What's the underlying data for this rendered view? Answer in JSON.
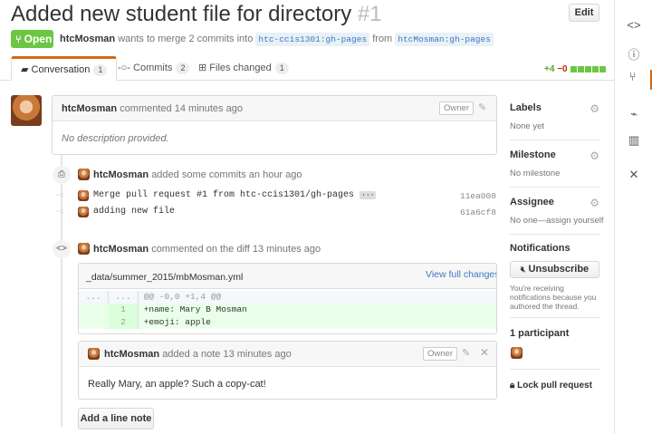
{
  "pr": {
    "title": "Added new student file for directory",
    "number": "#1",
    "edit_label": "Edit",
    "state": "Open",
    "author": "htcMosman",
    "merge_text": "wants to merge 2 commits into",
    "base_branch": "htc-ccis1301:gh-pages",
    "from_text": "from",
    "head_branch": "htcMosman:gh-pages"
  },
  "tabs": [
    {
      "label": "Conversation",
      "count": "1"
    },
    {
      "label": "Commits",
      "count": "2"
    },
    {
      "label": "Files changed",
      "count": "1"
    }
  ],
  "diffstat": {
    "additions": "+4",
    "deletions": "−0"
  },
  "comment1": {
    "author": "htcMosman",
    "action": "commented",
    "time": "14 minutes ago",
    "badge": "Owner",
    "body": "No description provided."
  },
  "commits_event": {
    "author": "htcMosman",
    "text": "added some commits an hour ago",
    "commits": [
      {
        "message": "Merge pull request #1 from htc-ccis1301/gh-pages",
        "ellipsis": "···",
        "sha": "11ea008"
      },
      {
        "message": "adding new file",
        "sha": "61a6cf8"
      }
    ]
  },
  "diff_event": {
    "author": "htcMosman",
    "text": "commented on the diff 13 minutes ago",
    "file": "_data/summer_2015/mbMosman.yml",
    "view_full": "View full changes",
    "hunk": {
      "old": "...",
      "new": "...",
      "text": "@@ -0,0 +1,4 @@"
    },
    "lines": [
      {
        "num": "1",
        "text": "+name: Mary B Mosman"
      },
      {
        "num": "2",
        "text": "+emoji: apple"
      }
    ],
    "note": {
      "author": "htcMosman",
      "text": "added a note 13 minutes ago",
      "badge": "Owner",
      "body": "Really Mary, an apple? Such a copy-cat!"
    },
    "add_note_label": "Add a line note"
  },
  "sidebar": {
    "labels_title": "Labels",
    "labels_value": "None yet",
    "milestone_title": "Milestone",
    "milestone_value": "No milestone",
    "assignee_title": "Assignee",
    "assignee_value": "No one—assign yourself",
    "notifications_title": "Notifications",
    "unsubscribe_label": "Unsubscribe",
    "notifications_note": "You're receiving notifications because you authored the thread.",
    "participants_title": "1 participant",
    "lock_label": "Lock pull request"
  },
  "colors": {
    "accent": "#d26911",
    "open": "#6cc644",
    "added": "#eaffea",
    "link": "#4078c0"
  }
}
